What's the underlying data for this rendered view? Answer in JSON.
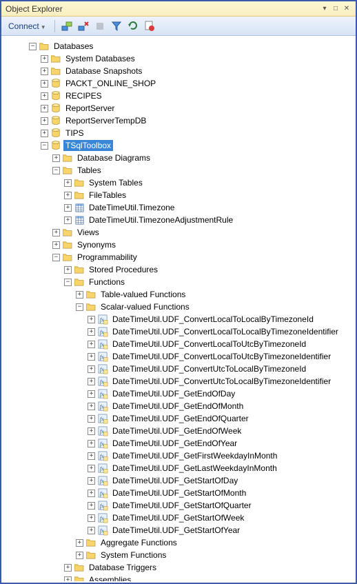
{
  "window": {
    "title": "Object Explorer"
  },
  "toolbar": {
    "connect_label": "Connect"
  },
  "tree": [
    {
      "d": 0,
      "exp": "-",
      "icon": "folder",
      "key": "databases",
      "label": "Databases"
    },
    {
      "d": 1,
      "exp": "+",
      "icon": "folder",
      "key": "sysdb",
      "label": "System Databases"
    },
    {
      "d": 1,
      "exp": "+",
      "icon": "folder",
      "key": "snaps",
      "label": "Database Snapshots"
    },
    {
      "d": 1,
      "exp": "+",
      "icon": "db",
      "key": "packt",
      "label": "PACKT_ONLINE_SHOP"
    },
    {
      "d": 1,
      "exp": "+",
      "icon": "db",
      "key": "recipes",
      "label": "RECIPES"
    },
    {
      "d": 1,
      "exp": "+",
      "icon": "db",
      "key": "rs",
      "label": "ReportServer"
    },
    {
      "d": 1,
      "exp": "+",
      "icon": "db",
      "key": "rstemp",
      "label": "ReportServerTempDB"
    },
    {
      "d": 1,
      "exp": "+",
      "icon": "db",
      "key": "tips",
      "label": "TIPS"
    },
    {
      "d": 1,
      "exp": "-",
      "icon": "db",
      "key": "tsql",
      "label": "TSqlToolbox",
      "selected": true
    },
    {
      "d": 2,
      "exp": "+",
      "icon": "folder",
      "key": "diag",
      "label": "Database Diagrams"
    },
    {
      "d": 2,
      "exp": "-",
      "icon": "folder",
      "key": "tables",
      "label": "Tables"
    },
    {
      "d": 3,
      "exp": "+",
      "icon": "folder",
      "key": "systables",
      "label": "System Tables"
    },
    {
      "d": 3,
      "exp": "+",
      "icon": "folder",
      "key": "filetables",
      "label": "FileTables"
    },
    {
      "d": 3,
      "exp": "+",
      "icon": "table",
      "key": "tz",
      "label": "DateTimeUtil.Timezone"
    },
    {
      "d": 3,
      "exp": "+",
      "icon": "table",
      "key": "tzrule",
      "label": "DateTimeUtil.TimezoneAdjustmentRule"
    },
    {
      "d": 2,
      "exp": "+",
      "icon": "folder",
      "key": "views",
      "label": "Views"
    },
    {
      "d": 2,
      "exp": "+",
      "icon": "folder",
      "key": "syn",
      "label": "Synonyms"
    },
    {
      "d": 2,
      "exp": "-",
      "icon": "folder",
      "key": "prog",
      "label": "Programmability"
    },
    {
      "d": 3,
      "exp": "+",
      "icon": "folder",
      "key": "sp",
      "label": "Stored Procedures"
    },
    {
      "d": 3,
      "exp": "-",
      "icon": "folder",
      "key": "fn",
      "label": "Functions"
    },
    {
      "d": 4,
      "exp": "+",
      "icon": "folder",
      "key": "tvf",
      "label": "Table-valued Functions"
    },
    {
      "d": 4,
      "exp": "-",
      "icon": "folder",
      "key": "svf",
      "label": "Scalar-valued Functions"
    },
    {
      "d": 5,
      "exp": "+",
      "icon": "fn",
      "key": "f1",
      "label": "DateTimeUtil.UDF_ConvertLocalToLocalByTimezoneId"
    },
    {
      "d": 5,
      "exp": "+",
      "icon": "fn",
      "key": "f2",
      "label": "DateTimeUtil.UDF_ConvertLocalToLocalByTimezoneIdentifier"
    },
    {
      "d": 5,
      "exp": "+",
      "icon": "fn",
      "key": "f3",
      "label": "DateTimeUtil.UDF_ConvertLocalToUtcByTimezoneId"
    },
    {
      "d": 5,
      "exp": "+",
      "icon": "fn",
      "key": "f4",
      "label": "DateTimeUtil.UDF_ConvertLocalToUtcByTimezoneIdentifier"
    },
    {
      "d": 5,
      "exp": "+",
      "icon": "fn",
      "key": "f5",
      "label": "DateTimeUtil.UDF_ConvertUtcToLocalByTimezoneId"
    },
    {
      "d": 5,
      "exp": "+",
      "icon": "fn",
      "key": "f6",
      "label": "DateTimeUtil.UDF_ConvertUtcToLocalByTimezoneIdentifier"
    },
    {
      "d": 5,
      "exp": "+",
      "icon": "fn",
      "key": "f7",
      "label": "DateTimeUtil.UDF_GetEndOfDay"
    },
    {
      "d": 5,
      "exp": "+",
      "icon": "fn",
      "key": "f8",
      "label": "DateTimeUtil.UDF_GetEndOfMonth"
    },
    {
      "d": 5,
      "exp": "+",
      "icon": "fn",
      "key": "f9",
      "label": "DateTimeUtil.UDF_GetEndOfQuarter"
    },
    {
      "d": 5,
      "exp": "+",
      "icon": "fn",
      "key": "f10",
      "label": "DateTimeUtil.UDF_GetEndOfWeek"
    },
    {
      "d": 5,
      "exp": "+",
      "icon": "fn",
      "key": "f11",
      "label": "DateTimeUtil.UDF_GetEndOfYear"
    },
    {
      "d": 5,
      "exp": "+",
      "icon": "fn",
      "key": "f12",
      "label": "DateTimeUtil.UDF_GetFirstWeekdayInMonth"
    },
    {
      "d": 5,
      "exp": "+",
      "icon": "fn",
      "key": "f13",
      "label": "DateTimeUtil.UDF_GetLastWeekdayInMonth"
    },
    {
      "d": 5,
      "exp": "+",
      "icon": "fn",
      "key": "f14",
      "label": "DateTimeUtil.UDF_GetStartOfDay"
    },
    {
      "d": 5,
      "exp": "+",
      "icon": "fn",
      "key": "f15",
      "label": "DateTimeUtil.UDF_GetStartOfMonth"
    },
    {
      "d": 5,
      "exp": "+",
      "icon": "fn",
      "key": "f16",
      "label": "DateTimeUtil.UDF_GetStartOfQuarter"
    },
    {
      "d": 5,
      "exp": "+",
      "icon": "fn",
      "key": "f17",
      "label": "DateTimeUtil.UDF_GetStartOfWeek"
    },
    {
      "d": 5,
      "exp": "+",
      "icon": "fn",
      "key": "f18",
      "label": "DateTimeUtil.UDF_GetStartOfYear"
    },
    {
      "d": 4,
      "exp": "+",
      "icon": "folder",
      "key": "aggfn",
      "label": "Aggregate Functions"
    },
    {
      "d": 4,
      "exp": "+",
      "icon": "folder",
      "key": "sysfn",
      "label": "System Functions"
    },
    {
      "d": 3,
      "exp": "+",
      "icon": "folder",
      "key": "dbtrig",
      "label": "Database Triggers"
    },
    {
      "d": 3,
      "exp": "+",
      "icon": "folder",
      "key": "asm",
      "label": "Assemblies"
    }
  ]
}
